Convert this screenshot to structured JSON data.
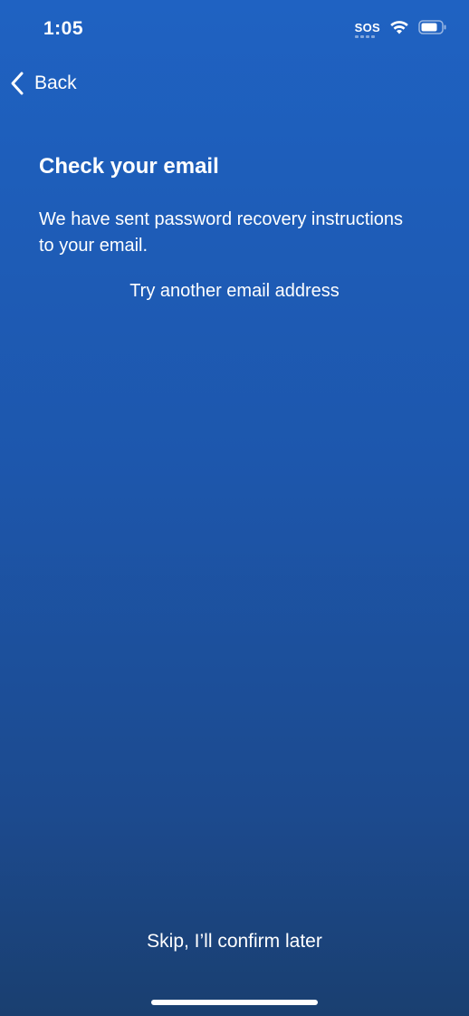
{
  "status_bar": {
    "time": "1:05",
    "sos": "SOS",
    "wifi_icon": "wifi-icon",
    "battery_icon": "battery-icon"
  },
  "nav": {
    "back_label": "Back",
    "back_icon": "chevron-left-icon"
  },
  "content": {
    "title": "Check your email",
    "description": "We have sent password recovery instructions to your email.",
    "try_another_label": "Try another email address"
  },
  "footer": {
    "skip_label": "Skip, I’ll confirm later"
  },
  "colors": {
    "background_top": "#1f62c2",
    "background_bottom": "#1a3f70",
    "text": "#ffffff"
  }
}
